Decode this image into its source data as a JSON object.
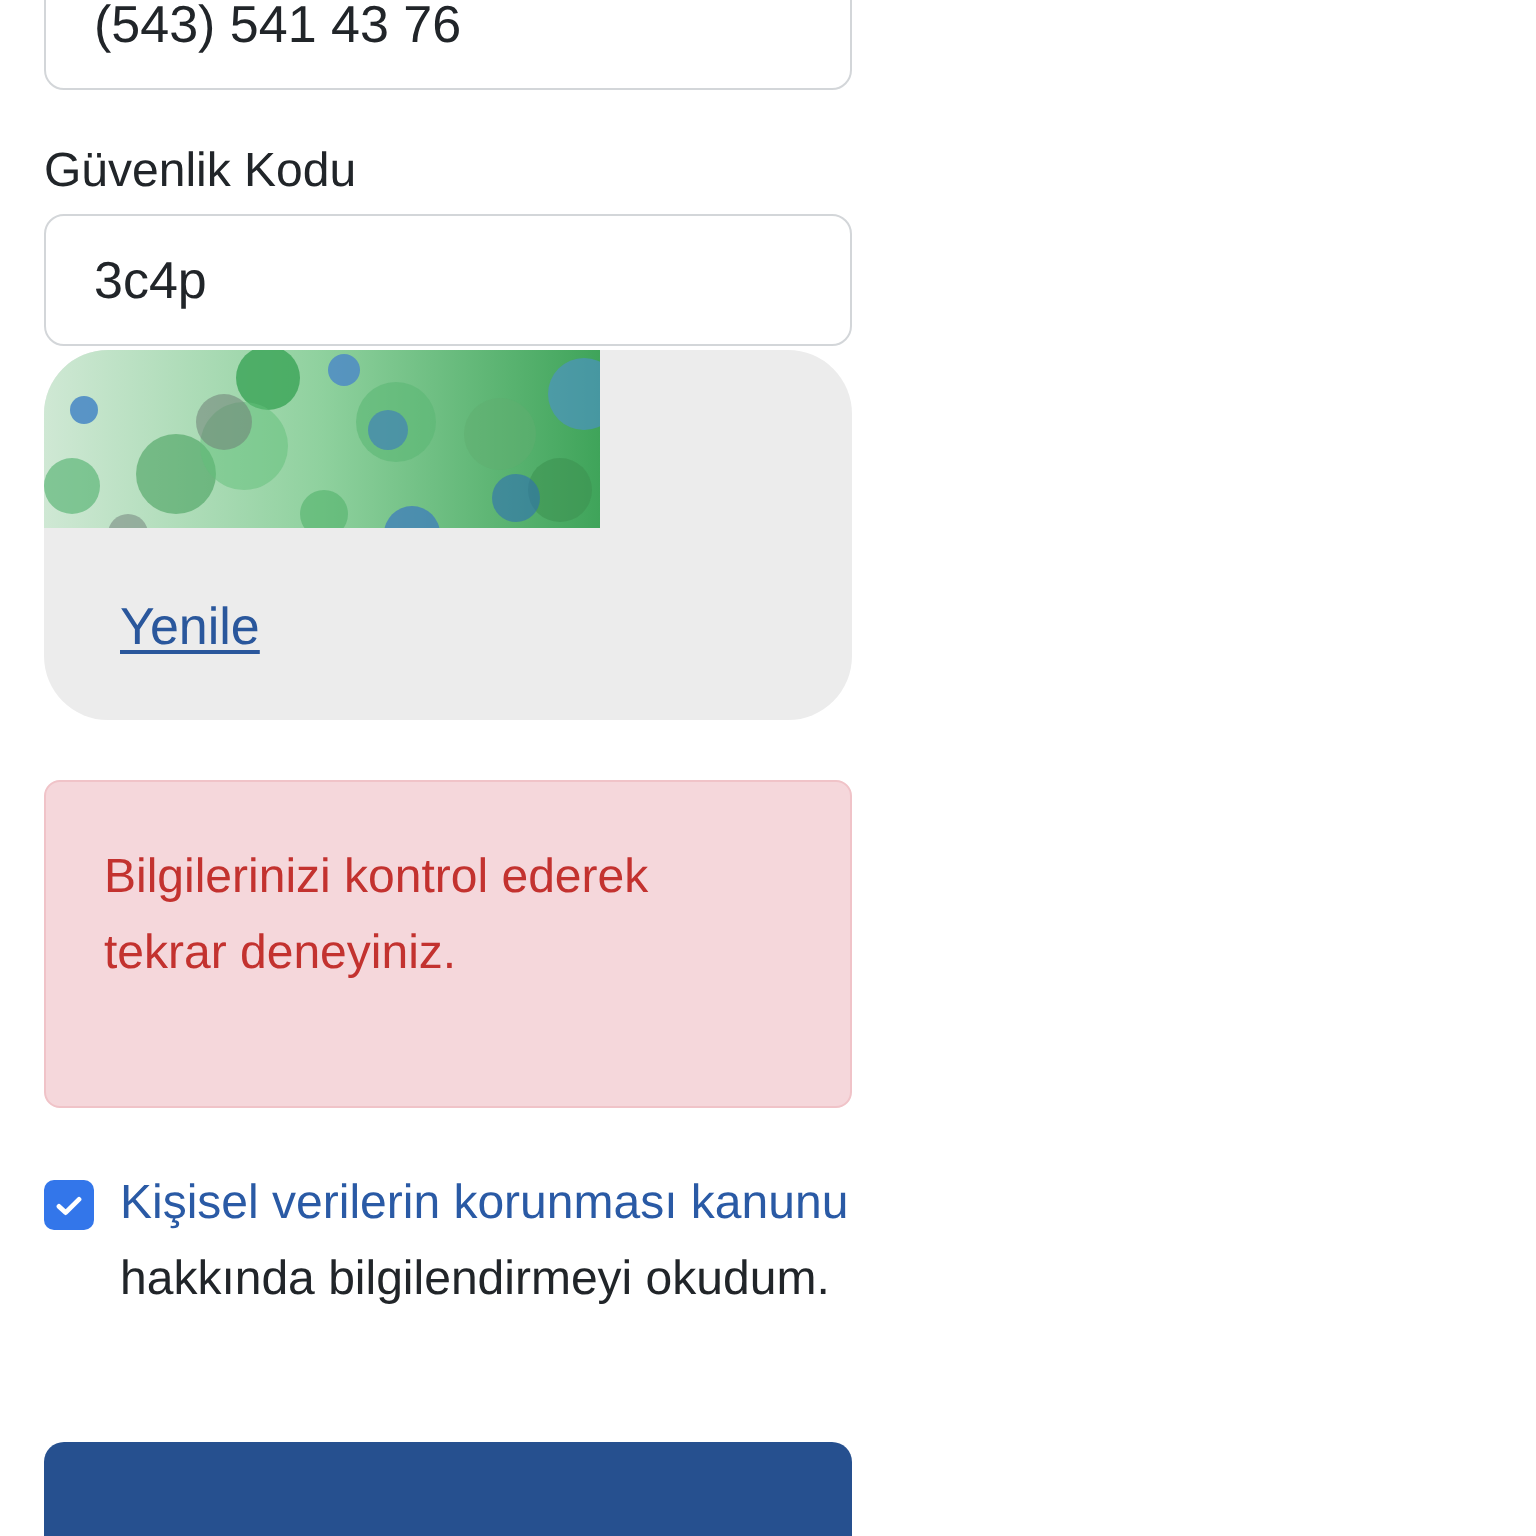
{
  "phone_field": {
    "value": "(543) 541 43 76"
  },
  "security_code": {
    "label": "Güvenlik Kodu",
    "value": "3c4p"
  },
  "captcha": {
    "refresh_link": "Yenile"
  },
  "alert": {
    "message": "Bilgilerinizi kontrol ederek tekrar deneyiniz."
  },
  "consent": {
    "checked": true,
    "link": "Kişisel verilerin korunması kanunu",
    "text": "hakkında bilgilendirmeyi okudum."
  }
}
